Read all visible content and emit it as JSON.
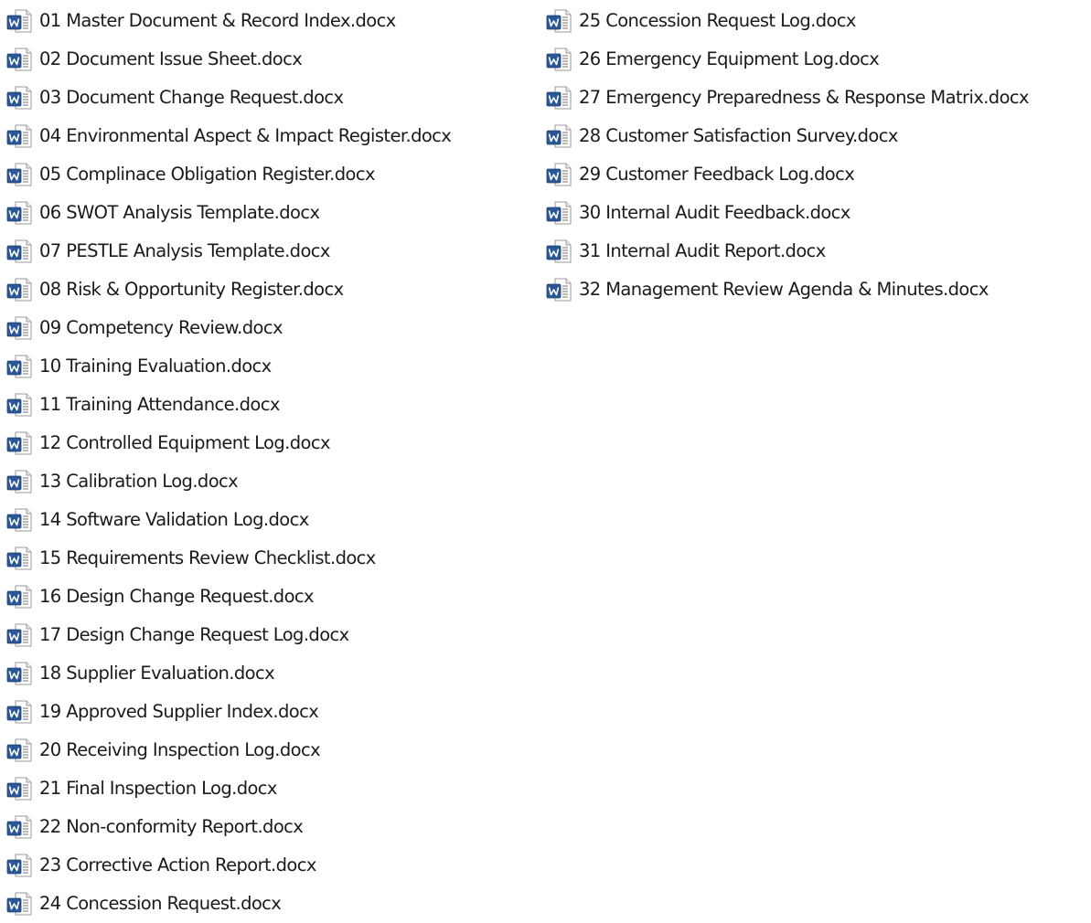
{
  "files": [
    {
      "name": "01 Master Document & Record Index.docx",
      "icon": "word-document-icon"
    },
    {
      "name": "02 Document Issue Sheet.docx",
      "icon": "word-document-icon"
    },
    {
      "name": "03 Document Change Request.docx",
      "icon": "word-document-icon"
    },
    {
      "name": "04 Environmental Aspect & Impact Register.docx",
      "icon": "word-document-icon"
    },
    {
      "name": "05 Complinace Obligation Register.docx",
      "icon": "word-document-icon"
    },
    {
      "name": "06 SWOT Analysis Template.docx",
      "icon": "word-document-icon"
    },
    {
      "name": "07 PESTLE Analysis Template.docx",
      "icon": "word-document-icon"
    },
    {
      "name": "08 Risk & Opportunity Register.docx",
      "icon": "word-document-icon"
    },
    {
      "name": "09 Competency Review.docx",
      "icon": "word-document-icon"
    },
    {
      "name": "10 Training Evaluation.docx",
      "icon": "word-document-icon"
    },
    {
      "name": "11 Training Attendance.docx",
      "icon": "word-document-icon"
    },
    {
      "name": "12 Controlled Equipment Log.docx",
      "icon": "word-document-icon"
    },
    {
      "name": "13 Calibration Log.docx",
      "icon": "word-document-icon"
    },
    {
      "name": "14 Software Validation Log.docx",
      "icon": "word-document-icon"
    },
    {
      "name": "15 Requirements Review Checklist.docx",
      "icon": "word-document-icon"
    },
    {
      "name": "16 Design Change Request.docx",
      "icon": "word-document-icon"
    },
    {
      "name": "17 Design Change Request Log.docx",
      "icon": "word-document-icon"
    },
    {
      "name": "18 Supplier Evaluation.docx",
      "icon": "word-document-icon"
    },
    {
      "name": "19 Approved Supplier Index.docx",
      "icon": "word-document-icon"
    },
    {
      "name": "20 Receiving Inspection Log.docx",
      "icon": "word-document-icon"
    },
    {
      "name": "21 Final Inspection Log.docx",
      "icon": "word-document-icon"
    },
    {
      "name": "22 Non-conformity Report.docx",
      "icon": "word-document-icon"
    },
    {
      "name": "23 Corrective Action Report.docx",
      "icon": "word-document-icon"
    },
    {
      "name": "24 Concession Request.docx",
      "icon": "word-document-icon"
    },
    {
      "name": "25 Concession Request Log.docx",
      "icon": "word-document-icon"
    },
    {
      "name": "26 Emergency Equipment Log.docx",
      "icon": "word-document-icon"
    },
    {
      "name": "27 Emergency Preparedness & Response Matrix.docx",
      "icon": "word-document-icon"
    },
    {
      "name": "28 Customer Satisfaction Survey.docx",
      "icon": "word-document-icon"
    },
    {
      "name": "29 Customer Feedback Log.docx",
      "icon": "word-document-icon"
    },
    {
      "name": "30 Internal Audit Feedback.docx",
      "icon": "word-document-icon"
    },
    {
      "name": "31 Internal Audit Report.docx",
      "icon": "word-document-icon"
    },
    {
      "name": "32 Management Review Agenda & Minutes.docx",
      "icon": "word-document-icon"
    }
  ],
  "colors": {
    "word_blue": "#2b5797",
    "page_border": "#9a9a9a",
    "text": "#1a1a1a"
  }
}
